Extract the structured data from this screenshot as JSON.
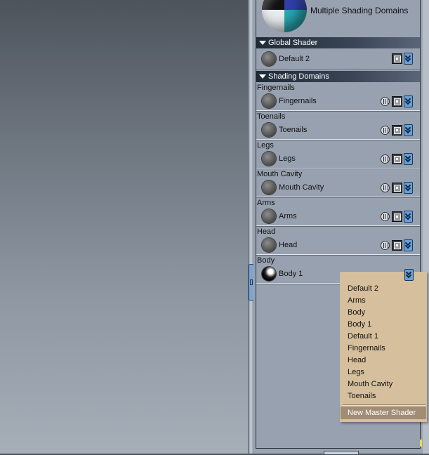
{
  "panel": {
    "preview_title": "Multiple Shading Domains",
    "global_section": "Global Shader",
    "global_shader": "Default 2",
    "domains_section": "Shading Domains",
    "domains": [
      {
        "label": "Fingernails",
        "shader": "Fingernails"
      },
      {
        "label": "Toenails",
        "shader": "Toenails"
      },
      {
        "label": "Legs",
        "shader": "Legs"
      },
      {
        "label": "Mouth Cavity",
        "shader": "Mouth Cavity"
      },
      {
        "label": "Arms",
        "shader": "Arms"
      },
      {
        "label": "Head",
        "shader": "Head"
      },
      {
        "label": "Body",
        "shader": "Body 1"
      }
    ]
  },
  "menu": {
    "items": [
      "Default 2",
      "Arms",
      "Body",
      "Body 1",
      "Default 1",
      "Fingernails",
      "Head",
      "Legs",
      "Mouth Cavity",
      "Toenails"
    ],
    "highlighted": "New Master Shader"
  },
  "icons": {
    "delete": "trash-icon",
    "edit": "dice-icon",
    "dropdown": "chevron-down-icon"
  },
  "colors": {
    "panel_bg": "#98a1b0",
    "section_bar": "#1f2a38",
    "menu_bg": "#d6bf9c",
    "menu_highlight": "#a08d74",
    "button_blue": "#6aa0d8"
  }
}
